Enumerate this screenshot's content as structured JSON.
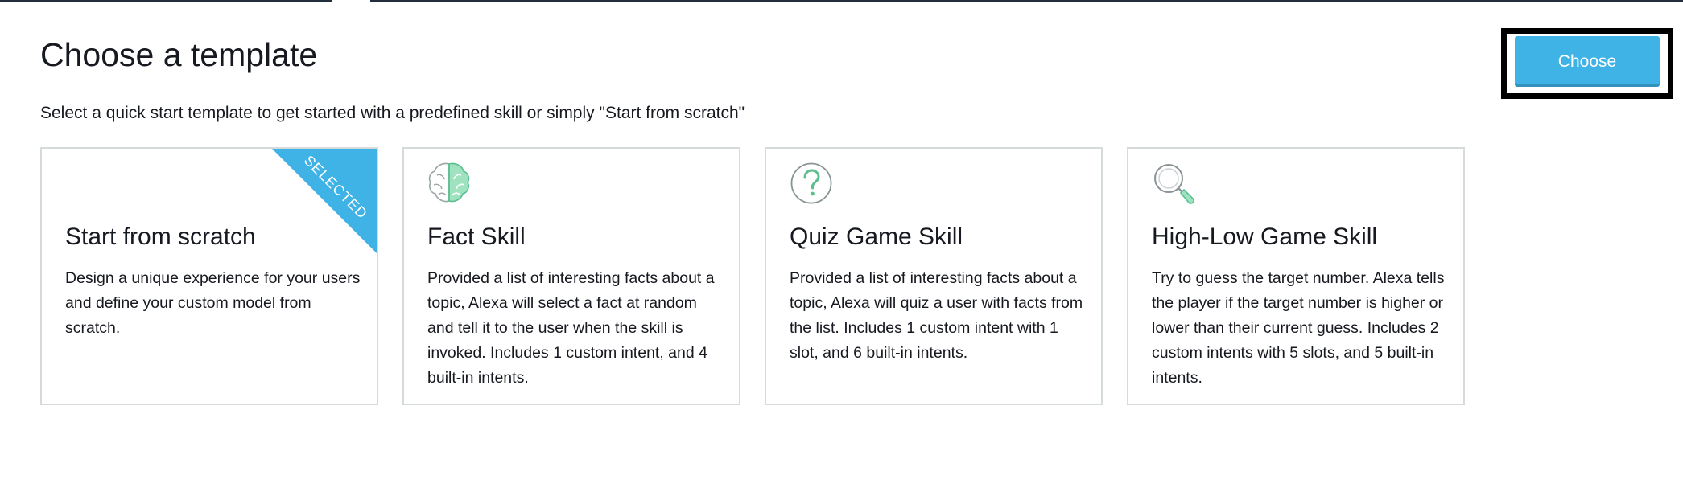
{
  "page": {
    "title": "Choose a template",
    "subtitle": "Select a quick start template to get started with a predefined skill or simply \"Start from scratch\""
  },
  "actions": {
    "choose_label": "Choose",
    "primary_color": "#3fb2e6"
  },
  "templates": [
    {
      "title": "Start from scratch",
      "description": "Design a unique experience for your users and define your custom model from scratch.",
      "icon": "",
      "selected": true,
      "badge": "SELECTED"
    },
    {
      "title": "Fact Skill",
      "description": "Provided a list of interesting facts about a topic, Alexa will select a fact at random and tell it to the user when the skill is invoked. Includes 1 custom intent, and 4 built-in intents.",
      "icon": "brain-icon",
      "selected": false
    },
    {
      "title": "Quiz Game Skill",
      "description": "Provided a list of interesting facts about a topic, Alexa will quiz a user with facts from the list. Includes 1 custom intent with 1 slot, and 6 built-in intents.",
      "icon": "question-mark-icon",
      "selected": false
    },
    {
      "title": "High-Low Game Skill",
      "description": "Try to guess the target number. Alexa tells the player if the target number is higher or lower than their current guess. Includes 2 custom intents with 5 slots, and 5 built-in intents.",
      "icon": "magnifier-icon",
      "selected": false
    }
  ],
  "colors": {
    "selected_badge": "#3fb2e6",
    "icon_accent": "#7fd3a8",
    "card_border": "#d5dbdb"
  }
}
